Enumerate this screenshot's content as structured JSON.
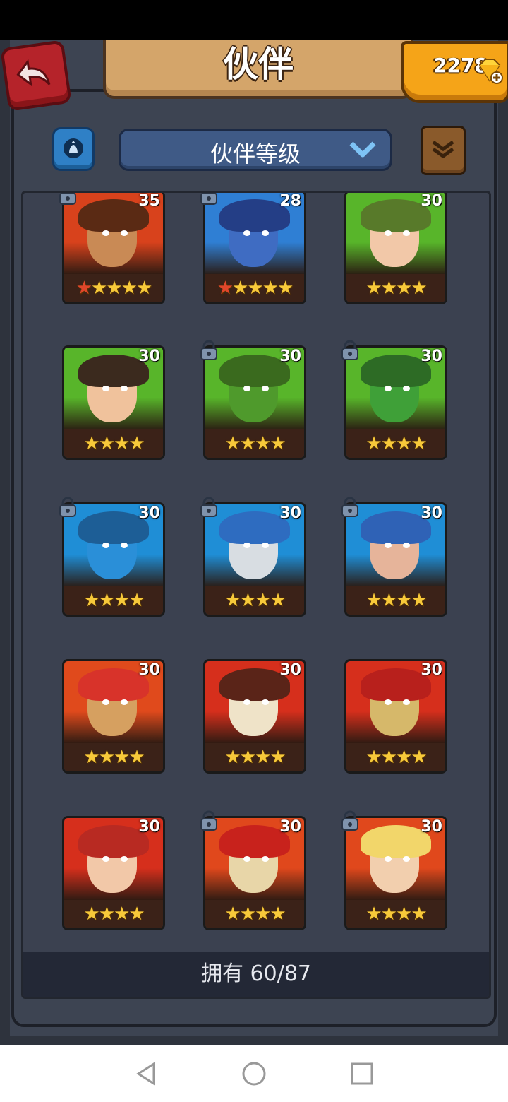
{
  "header": {
    "title": "伙伴",
    "gem_count": "2278",
    "back_icon": "back-arrow-icon",
    "gem_icon": "gem-plus-icon"
  },
  "toolbar": {
    "sort_label": "伙伴等级",
    "filter_icon": "filter-icon",
    "book_icon": "book-icon",
    "chevron_icon": "chevron-down-icon"
  },
  "heroes": [
    {
      "level": "35",
      "stars": [
        "★",
        "★",
        "★",
        "★",
        "★"
      ],
      "red_stars": 1,
      "locked": true,
      "bg": "#d8421c",
      "face": "#c98a55",
      "hair": "#5a2a14"
    },
    {
      "level": "28",
      "stars": [
        "★",
        "★",
        "★",
        "★",
        "★"
      ],
      "red_stars": 1,
      "locked": true,
      "bg": "#2f7fd4",
      "face": "#3f6cc2",
      "hair": "#243e86"
    },
    {
      "level": "30",
      "stars": [
        "★",
        "★",
        "★",
        "★"
      ],
      "red_stars": 0,
      "locked": false,
      "bg": "#58b52a",
      "face": "#f2c8a8",
      "hair": "#587a2a"
    },
    {
      "level": "30",
      "stars": [
        "★",
        "★",
        "★",
        "★"
      ],
      "red_stars": 0,
      "locked": false,
      "bg": "#58b52a",
      "face": "#f0c29c",
      "hair": "#3b2a1e"
    },
    {
      "level": "30",
      "stars": [
        "★",
        "★",
        "★",
        "★"
      ],
      "red_stars": 0,
      "locked": true,
      "bg": "#58b52a",
      "face": "#4f9a2c",
      "hair": "#3a6a1e"
    },
    {
      "level": "30",
      "stars": [
        "★",
        "★",
        "★",
        "★"
      ],
      "red_stars": 0,
      "locked": true,
      "bg": "#58b52a",
      "face": "#3fa038",
      "hair": "#2d6b25"
    },
    {
      "level": "30",
      "stars": [
        "★",
        "★",
        "★",
        "★"
      ],
      "red_stars": 0,
      "locked": true,
      "bg": "#1f8ed6",
      "face": "#2a8fd8",
      "hair": "#1d5e96"
    },
    {
      "level": "30",
      "stars": [
        "★",
        "★",
        "★",
        "★"
      ],
      "red_stars": 0,
      "locked": true,
      "bg": "#1f8ed6",
      "face": "#d8dde2",
      "hair": "#2e6cc0"
    },
    {
      "level": "30",
      "stars": [
        "★",
        "★",
        "★",
        "★"
      ],
      "red_stars": 0,
      "locked": true,
      "bg": "#1f8ed6",
      "face": "#e6b49a",
      "hair": "#2f62b6"
    },
    {
      "level": "30",
      "stars": [
        "★",
        "★",
        "★",
        "★"
      ],
      "red_stars": 0,
      "locked": false,
      "bg": "#e04a1c",
      "face": "#d6a060",
      "hair": "#d8332a"
    },
    {
      "level": "30",
      "stars": [
        "★",
        "★",
        "★",
        "★"
      ],
      "red_stars": 0,
      "locked": false,
      "bg": "#d62f1c",
      "face": "#efe3c8",
      "hair": "#5a2418"
    },
    {
      "level": "30",
      "stars": [
        "★",
        "★",
        "★",
        "★"
      ],
      "red_stars": 0,
      "locked": false,
      "bg": "#d62f1c",
      "face": "#d6b86a",
      "hair": "#b8201c"
    },
    {
      "level": "30",
      "stars": [
        "★",
        "★",
        "★",
        "★"
      ],
      "red_stars": 0,
      "locked": false,
      "bg": "#d62f1c",
      "face": "#f2c8a8",
      "hair": "#b82a22"
    },
    {
      "level": "30",
      "stars": [
        "★",
        "★",
        "★",
        "★"
      ],
      "red_stars": 0,
      "locked": true,
      "bg": "#e0481c",
      "face": "#e8d6a8",
      "hair": "#c8221c"
    },
    {
      "level": "30",
      "stars": [
        "★",
        "★",
        "★",
        "★"
      ],
      "red_stars": 0,
      "locked": true,
      "bg": "#e0481c",
      "face": "#f2cfae",
      "hair": "#f2d66a"
    }
  ],
  "footer": {
    "owned_text": "拥有 60/87"
  },
  "nav": {
    "back_icon": "nav-back-icon",
    "home_icon": "nav-home-icon",
    "recents_icon": "nav-recents-icon"
  }
}
